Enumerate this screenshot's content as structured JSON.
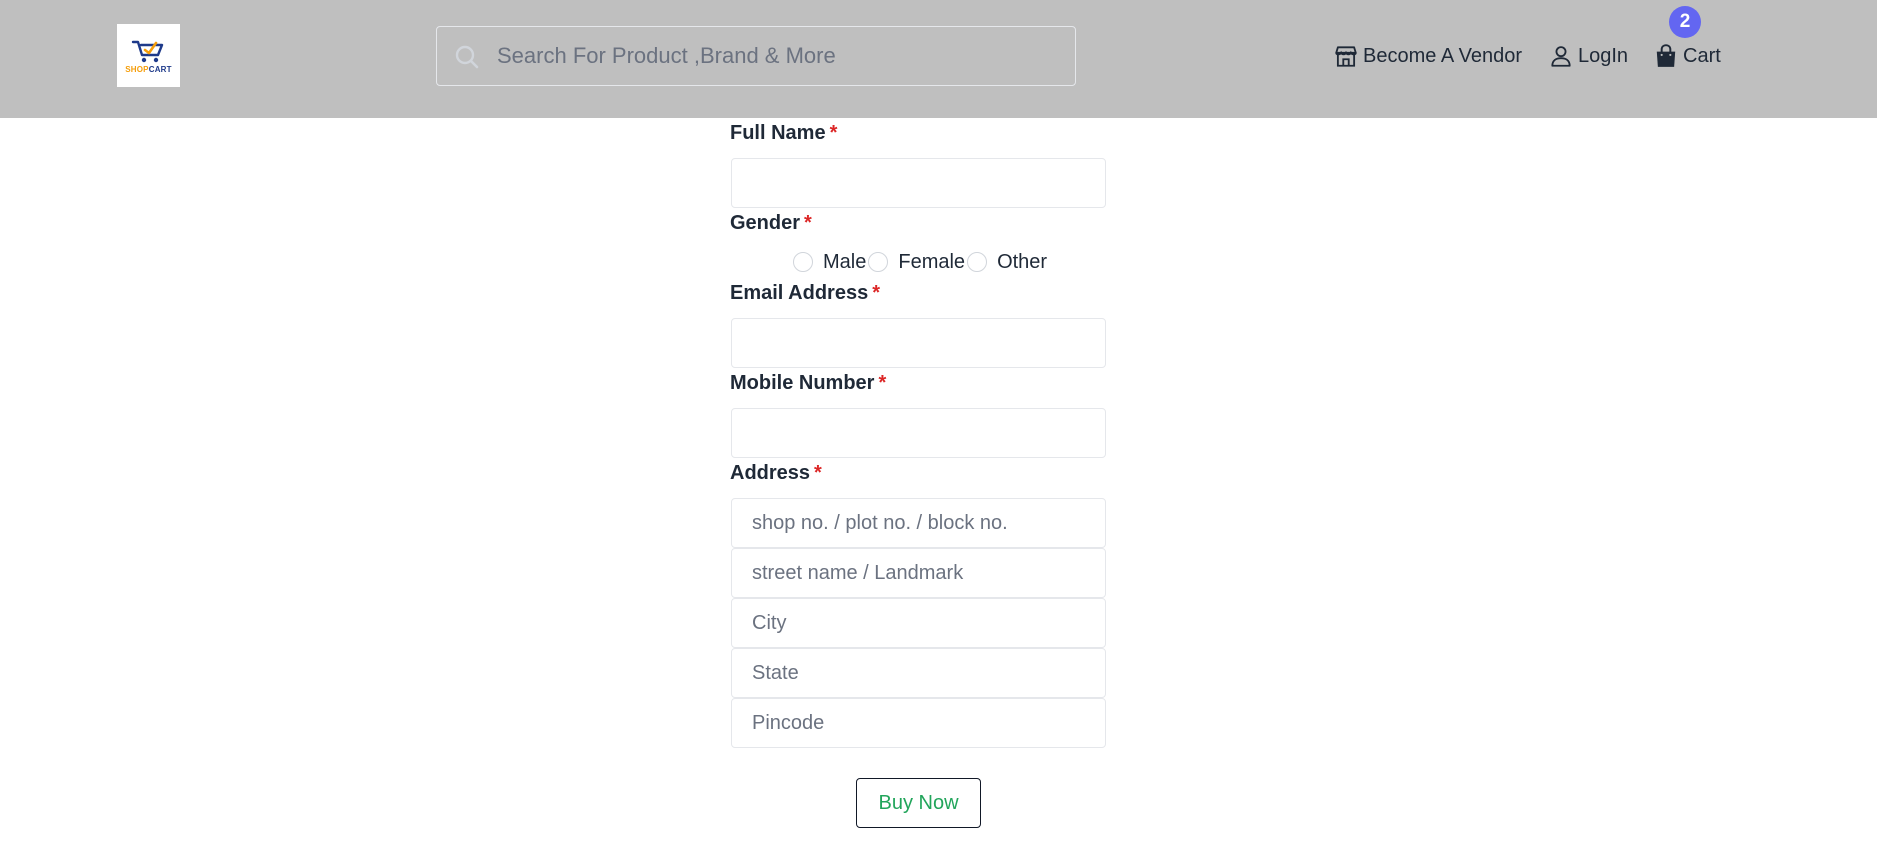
{
  "header": {
    "logo": {
      "word_shop": "SHOP",
      "word_cart": "CART"
    },
    "search": {
      "placeholder": "Search For Product ,Brand & More"
    },
    "nav": {
      "vendor_label": "Become A Vendor",
      "login_label": "LogIn",
      "cart_label": "Cart",
      "cart_count": "2"
    }
  },
  "form": {
    "full_name": {
      "label": "Full Name",
      "required_mark": "*",
      "value": ""
    },
    "gender": {
      "label": "Gender",
      "required_mark": "*",
      "options": [
        "Male",
        "Female",
        "Other"
      ]
    },
    "email": {
      "label": "Email Address",
      "required_mark": "*",
      "value": ""
    },
    "mobile": {
      "label": "Mobile Number",
      "required_mark": "*",
      "value": ""
    },
    "address": {
      "label": "Address",
      "required_mark": "*",
      "shop_placeholder": "shop no. / plot no. / block no.",
      "street_placeholder": "street name / Landmark",
      "city_placeholder": "City",
      "state_placeholder": "State",
      "pincode_placeholder": "Pincode"
    },
    "submit_label": "Buy Now"
  },
  "colors": {
    "header_bg": "#bfbfbf",
    "badge": "#6366f1",
    "required": "#dc2626",
    "buy_text": "#22a55b"
  }
}
